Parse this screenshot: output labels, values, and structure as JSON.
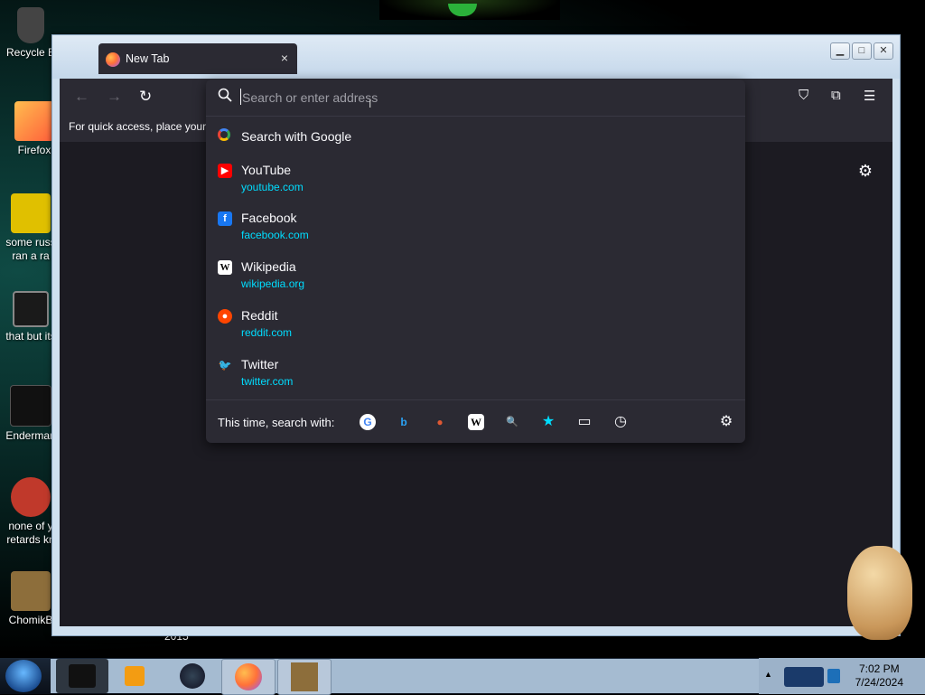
{
  "desktop": {
    "icons": [
      {
        "label": "Recycle B",
        "color": "#555"
      },
      {
        "label": "Firefox",
        "color": "#f5a623"
      },
      {
        "label": "some russ ran a ra",
        "color": "#e0c000"
      },
      {
        "label": "that but its",
        "color": "#777"
      },
      {
        "label": "Enderman",
        "color": "#222"
      },
      {
        "label": "none of y retards kn",
        "color": "#c0392b"
      },
      {
        "label": "ChomikB",
        "color": "#8d6e3b"
      }
    ],
    "year_label": "2015"
  },
  "window": {
    "tab": {
      "title": "New Tab",
      "close_icon": "×"
    },
    "caption": {
      "minimize": "▁",
      "maximize": "□",
      "close": "✕"
    },
    "nav": {
      "back_icon": "←",
      "forward_icon": "→",
      "reload_icon": "↻"
    },
    "toolbar_icons": {
      "pocket": "⛉",
      "extensions": "⧉",
      "menu": "☰"
    },
    "bookmarks_hint": "For quick access, place your b",
    "settings_icon": "⚙"
  },
  "urlbar": {
    "placeholder": "Search or enter address",
    "value": ""
  },
  "suggestions": {
    "search_with_google": "Search with Google",
    "sites": [
      {
        "name": "YouTube",
        "url": "youtube.com",
        "icon_color": "#ff0000",
        "icon_char": "▶"
      },
      {
        "name": "Facebook",
        "url": "facebook.com",
        "icon_color": "#1877f2",
        "icon_char": "f"
      },
      {
        "name": "Wikipedia",
        "url": "wikipedia.org",
        "icon_color": "#ffffff",
        "icon_char": "W"
      },
      {
        "name": "Reddit",
        "url": "reddit.com",
        "icon_color": "#ff4500",
        "icon_char": "●"
      },
      {
        "name": "Twitter",
        "url": "twitter.com",
        "icon_color": "#1da1f2",
        "icon_char": "🐦"
      }
    ]
  },
  "footer": {
    "label": "This time, search with:",
    "engines": [
      {
        "name": "google",
        "char": "G",
        "color": "#4285f4",
        "bg": "#ffffff"
      },
      {
        "name": "bing",
        "char": "b",
        "color": "#2aa3f5",
        "bg": "transparent"
      },
      {
        "name": "duckduckgo",
        "char": "●",
        "color": "#de5833",
        "bg": "transparent"
      },
      {
        "name": "wikipedia",
        "char": "W",
        "color": "#000000",
        "bg": "#ffffff"
      },
      {
        "name": "search-engine",
        "char": "🔍",
        "color": "#bbbbbb",
        "bg": "transparent"
      },
      {
        "name": "bookmarks",
        "char": "★",
        "color": "#00ddff",
        "bg": "transparent"
      },
      {
        "name": "tabs",
        "char": "▭",
        "color": "#fbfbfe",
        "bg": "transparent"
      },
      {
        "name": "history",
        "char": "◷",
        "color": "#fbfbfe",
        "bg": "transparent"
      }
    ],
    "settings_icon": "⚙"
  },
  "taskbar": {
    "time": "7:02 PM",
    "date": "7/24/2024",
    "tray_arrow": "▲"
  }
}
